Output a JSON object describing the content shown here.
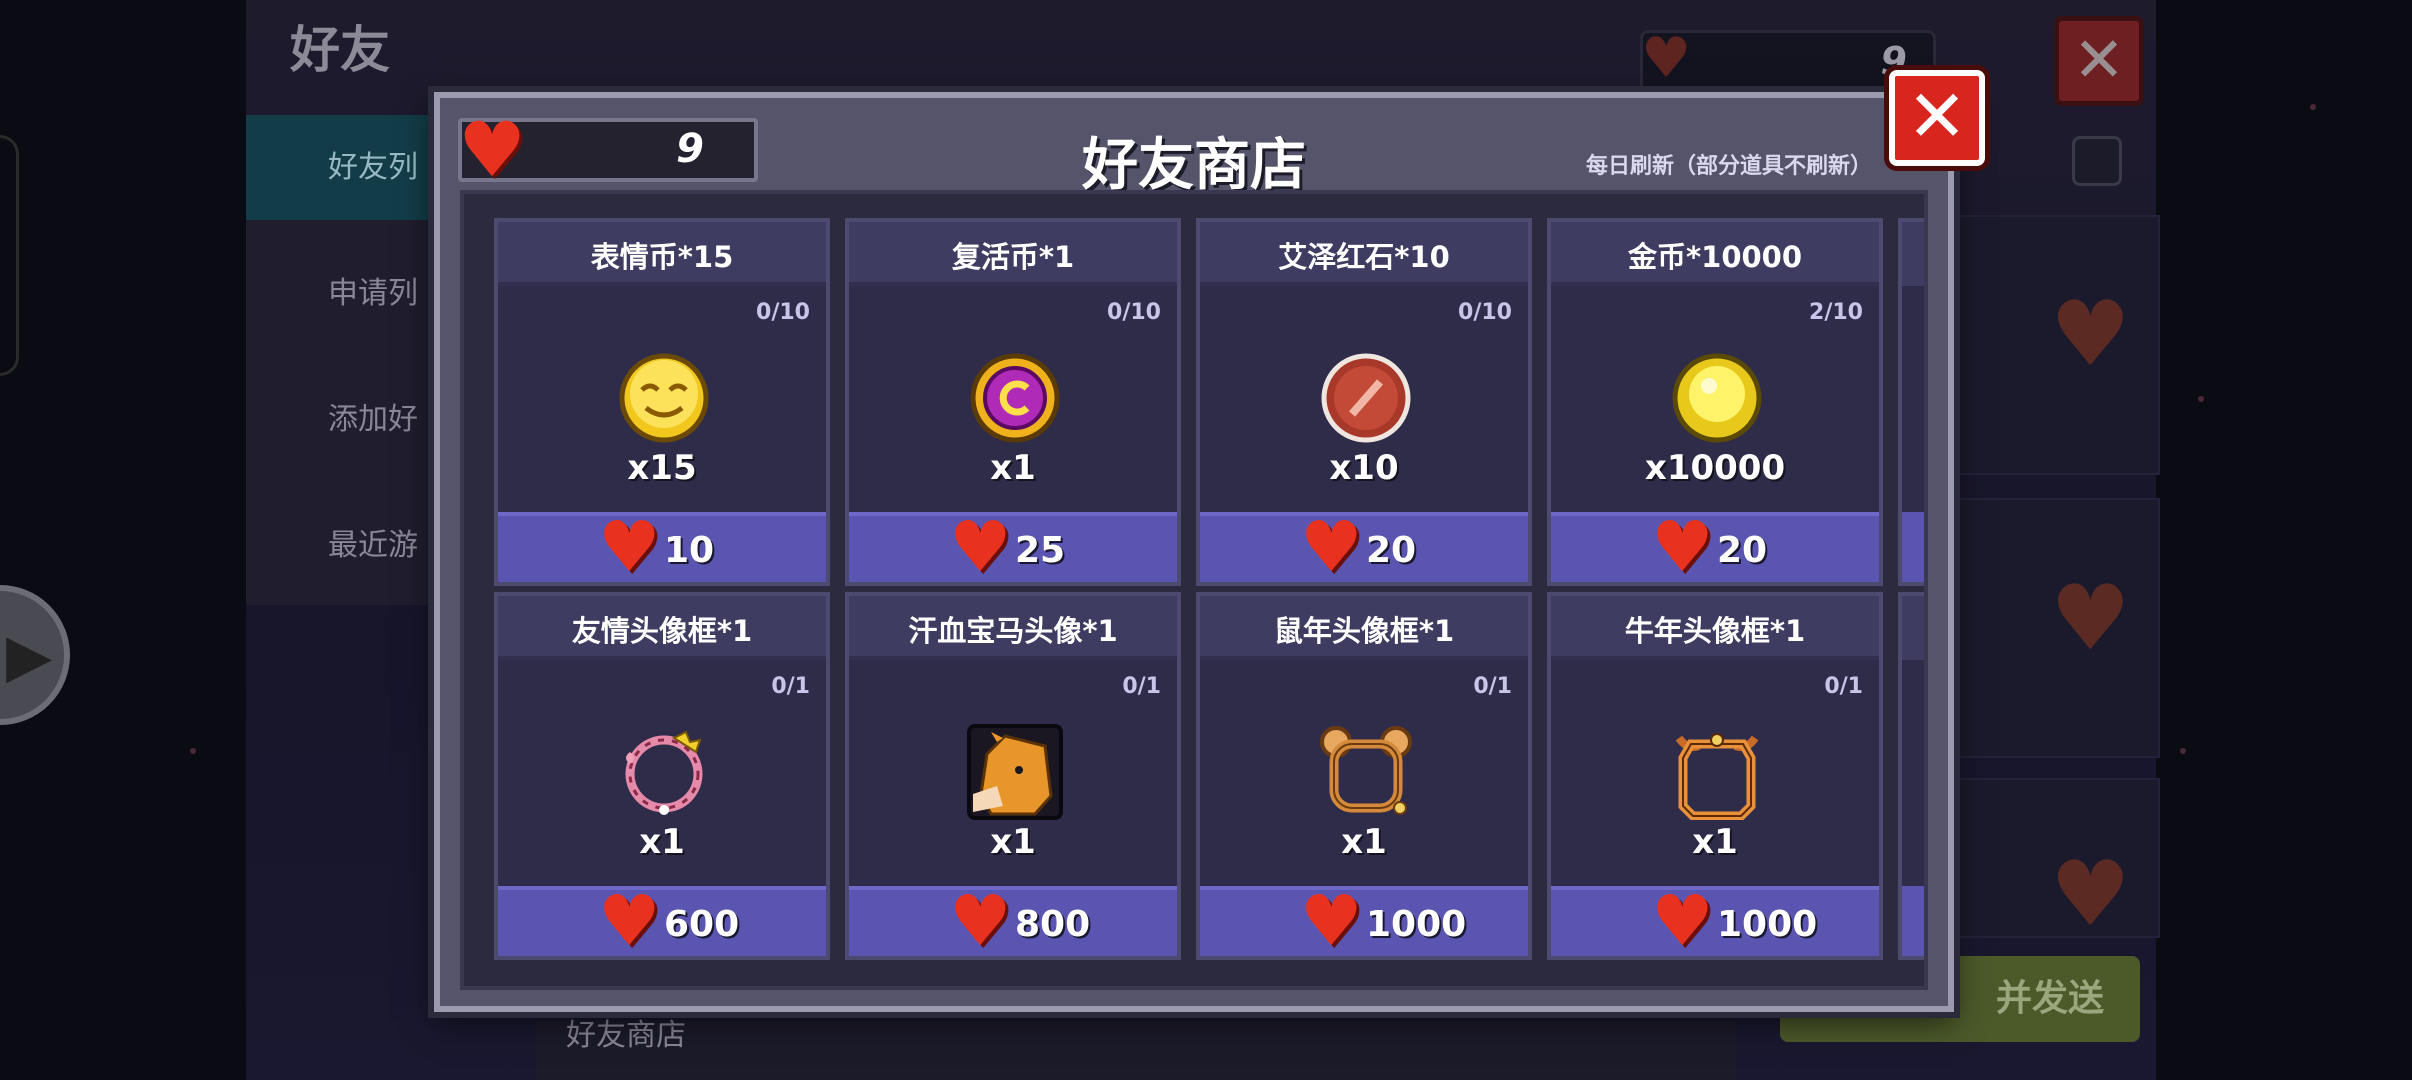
{
  "background": {
    "page_title": "好友",
    "tabs": [
      "好友列",
      "申请列",
      "添加好",
      "最近游"
    ],
    "heart_count": "9",
    "footer_label": "好友商店",
    "send_button": "并发送"
  },
  "shop": {
    "title": "好友商店",
    "currency_value": "9",
    "refresh_note": "每日刷新（部分道具不刷新）",
    "close_symbol": "✕",
    "items": [
      {
        "name": "表情币*15",
        "limit": "0/10",
        "qty": "x15",
        "price": "10",
        "icon": "emoji-coin-icon"
      },
      {
        "name": "复活币*1",
        "limit": "0/10",
        "qty": "x1",
        "price": "25",
        "icon": "revive-coin-icon"
      },
      {
        "name": "艾泽红石*10",
        "limit": "0/10",
        "qty": "x10",
        "price": "20",
        "icon": "red-stone-icon"
      },
      {
        "name": "金币*10000",
        "limit": "2/10",
        "qty": "x10000",
        "price": "20",
        "icon": "gold-coin-icon"
      },
      {
        "name": "友情头像框*1",
        "limit": "0/1",
        "qty": "x1",
        "price": "600",
        "icon": "friendship-frame-icon"
      },
      {
        "name": "汗血宝马头像*1",
        "limit": "0/1",
        "qty": "x1",
        "price": "800",
        "icon": "horse-avatar-icon"
      },
      {
        "name": "鼠年头像框*1",
        "limit": "0/1",
        "qty": "x1",
        "price": "1000",
        "icon": "rat-frame-icon"
      },
      {
        "name": "牛年头像框*1",
        "limit": "0/1",
        "qty": "x1",
        "price": "1000",
        "icon": "ox-frame-icon"
      }
    ]
  }
}
